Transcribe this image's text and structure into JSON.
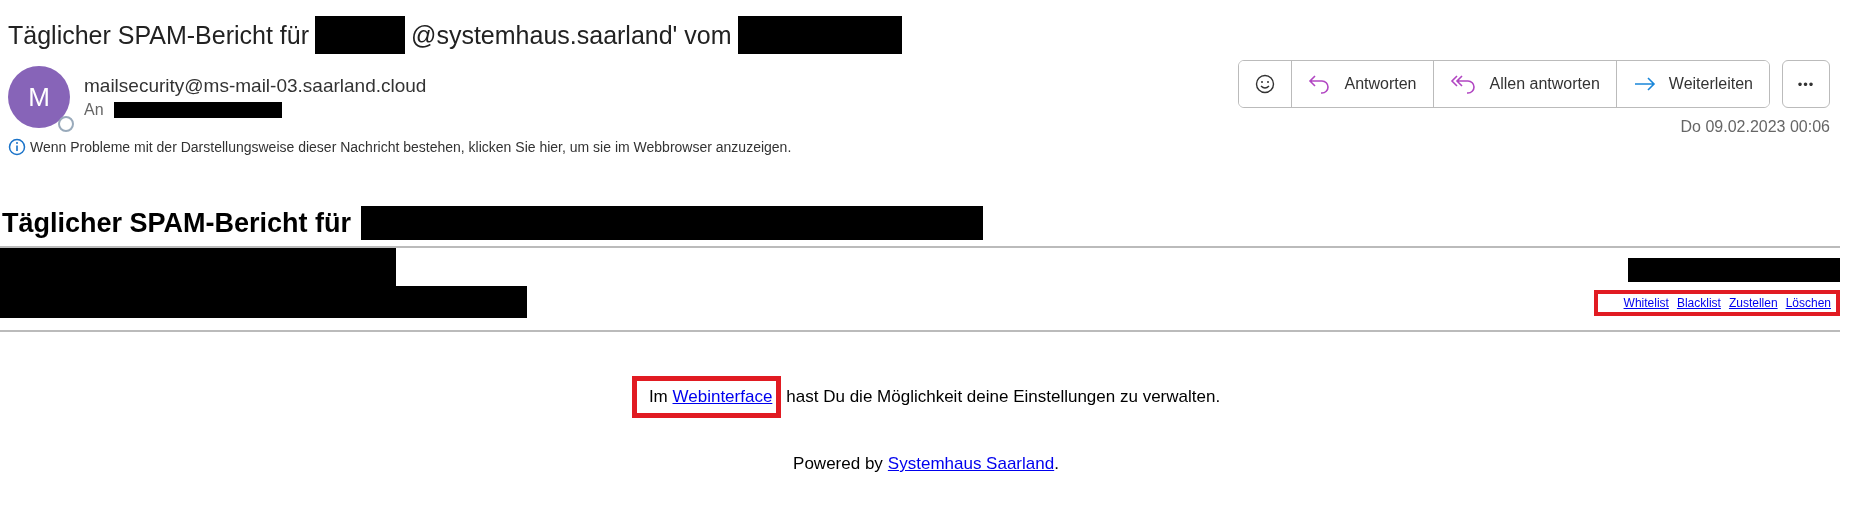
{
  "subject": {
    "prefix": "Täglicher SPAM-Bericht für",
    "middle": "@systemhaus.saarland' vom"
  },
  "sender": {
    "avatar_letter": "M",
    "address": "mailsecurity@ms-mail-03.saarland.cloud",
    "to_label": "An"
  },
  "info": "Wenn Probleme mit der Darstellungsweise dieser Nachricht bestehen, klicken Sie hier, um sie im Webbrowser anzuzeigen.",
  "actions": [
    {
      "kind": "emoji"
    },
    {
      "kind": "reply",
      "label": "Antworten"
    },
    {
      "kind": "reply-all",
      "label": "Allen antworten"
    },
    {
      "kind": "forward",
      "label": "Weiterleiten"
    }
  ],
  "more_button": "•••",
  "date": "Do 09.02.2023 00:06",
  "report": {
    "heading": "Täglicher SPAM-Bericht für",
    "links": [
      "Whitelist",
      "Blacklist",
      "Zustellen",
      "Löschen"
    ],
    "settings": {
      "before": "Im",
      "link": "Webinterface",
      "after": "hast Du die Möglichkeit deine Einstellungen zu verwalten."
    },
    "powered": {
      "before": "Powered by",
      "link": "Systemhaus Saarland",
      "after": "."
    }
  }
}
